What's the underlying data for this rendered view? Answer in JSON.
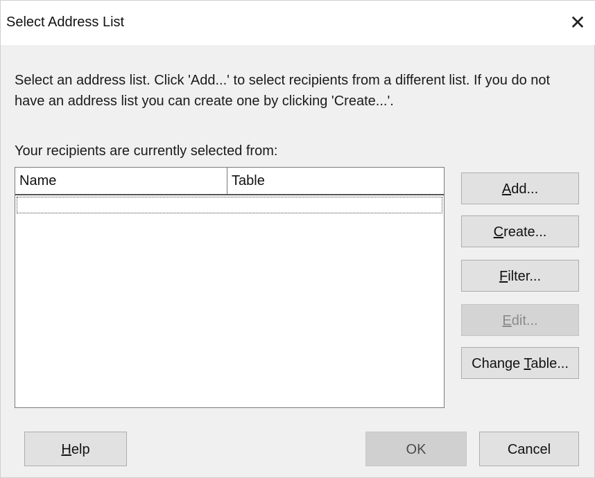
{
  "dialog": {
    "title": "Select Address List",
    "close_glyph": "✕",
    "description": "Select an address list. Click 'Add...' to select recipients from a different list. If you do not have an address list you can create one by clicking 'Create...'.",
    "recipients_label": "Your recipients are currently selected from:"
  },
  "list": {
    "columns": [
      "Name",
      "Table"
    ],
    "rows": []
  },
  "buttons": {
    "add": {
      "mnemonic": "A",
      "rest": "dd..."
    },
    "create": {
      "mnemonic": "C",
      "rest": "reate..."
    },
    "filter": {
      "mnemonic": "F",
      "rest": "ilter..."
    },
    "edit": {
      "mnemonic": "E",
      "rest": "dit..."
    },
    "change_table": {
      "pre": "Change ",
      "mnemonic": "T",
      "rest": "able..."
    },
    "help": {
      "mnemonic": "H",
      "rest": "elp"
    },
    "ok": "OK",
    "cancel": "Cancel"
  },
  "colors": {
    "dialog_bg": "#f0f0f0",
    "titlebar_bg": "#ffffff",
    "button_bg": "#e1e1e1",
    "disabled_text": "#8a8a8a"
  }
}
